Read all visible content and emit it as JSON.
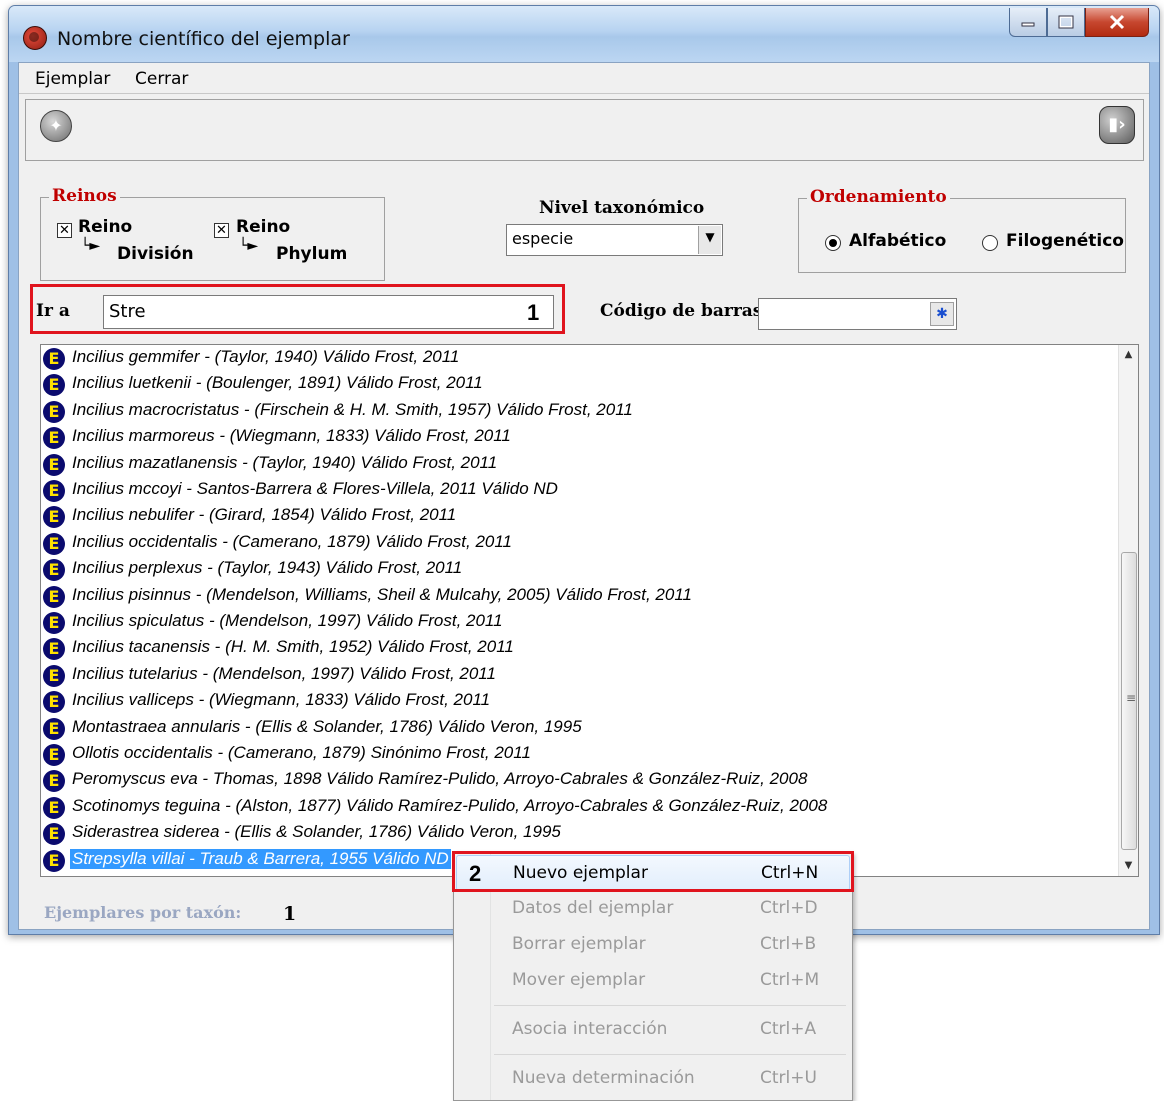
{
  "window": {
    "title": "Nombre científico del ejemplar"
  },
  "menu": [
    {
      "label": "Ejemplar"
    },
    {
      "label": "Cerrar"
    }
  ],
  "toolbar": {
    "left_icon": "new-specimen-icon",
    "right_icon": "exit-door-icon"
  },
  "reinos": {
    "title": "Reinos",
    "options": [
      {
        "line1": "Reino",
        "line2": "División",
        "checked": true
      },
      {
        "line1": "Reino",
        "line2": "Phylum",
        "checked": true
      }
    ]
  },
  "nivel": {
    "label": "Nivel taxonómico",
    "label_underline_char": "t",
    "value": "especie"
  },
  "ordenamiento": {
    "title": "Ordenamiento",
    "options": [
      {
        "label": "Alfabético",
        "selected": true
      },
      {
        "label": "Filogenético",
        "selected": false
      }
    ]
  },
  "ir_a": {
    "label": "Ir a",
    "value": "Stre",
    "step_number": "1"
  },
  "codigo": {
    "label": "Código de barras",
    "value": "",
    "button_icon": "asterisk-icon"
  },
  "list": {
    "icon_letter": "E",
    "rows": [
      "Incilius gemmifer - (Taylor, 1940)  Válido  Frost, 2011",
      "Incilius luetkenii - (Boulenger, 1891)  Válido  Frost, 2011",
      "Incilius macrocristatus - (Firschein & H. M. Smith, 1957)  Válido  Frost, 2011",
      "Incilius marmoreus - (Wiegmann, 1833)  Válido  Frost, 2011",
      "Incilius mazatlanensis - (Taylor, 1940)  Válido  Frost, 2011",
      "Incilius mccoyi - Santos-Barrera & Flores-Villela, 2011  Válido  ND",
      "Incilius nebulifer - (Girard, 1854)  Válido  Frost, 2011",
      "Incilius occidentalis - (Camerano, 1879)  Válido  Frost, 2011",
      "Incilius perplexus - (Taylor, 1943)  Válido  Frost, 2011",
      "Incilius pisinnus - (Mendelson, Williams, Sheil & Mulcahy, 2005)  Válido  Frost, 2011",
      "Incilius spiculatus - (Mendelson, 1997)  Válido  Frost, 2011",
      "Incilius tacanensis - (H. M. Smith, 1952)  Válido  Frost, 2011",
      "Incilius tutelarius - (Mendelson, 1997)  Válido  Frost, 2011",
      "Incilius valliceps - (Wiegmann, 1833)  Válido  Frost, 2011",
      "Montastraea annularis - (Ellis & Solander, 1786)  Válido  Veron, 1995",
      "Ollotis occidentalis - (Camerano, 1879)  Sinónimo   Frost, 2011",
      "Peromyscus eva - Thomas, 1898  Válido  Ramírez-Pulido, Arroyo-Cabrales & González-Ruiz, 2008",
      "Scotinomys teguina - (Alston, 1877)  Válido  Ramírez-Pulido, Arroyo-Cabrales & González-Ruiz, 2008",
      "Siderastrea siderea - (Ellis & Solander, 1786)  Válido  Veron, 1995",
      "Strepsylla villai - Traub & Barrera, 1955  Válido  ND"
    ],
    "selected_index": 19
  },
  "footer": {
    "label": "Ejemplares por taxón:",
    "value": "1"
  },
  "context_menu": {
    "step_number": "2",
    "items": [
      {
        "label": "Nuevo ejemplar",
        "shortcut": "Ctrl+N",
        "enabled": true,
        "highlighted": true
      },
      {
        "label": "Datos del ejemplar",
        "shortcut": "Ctrl+D",
        "enabled": false
      },
      {
        "label": "Borrar ejemplar",
        "shortcut": "Ctrl+B",
        "enabled": false
      },
      {
        "label": "Mover ejemplar",
        "shortcut": "Ctrl+M",
        "enabled": false
      },
      {
        "separator": true
      },
      {
        "label": "Asocia interacción",
        "shortcut": "Ctrl+A",
        "enabled": false
      },
      {
        "separator": true
      },
      {
        "label": "Nueva determinación",
        "shortcut": "Ctrl+U",
        "enabled": false
      }
    ]
  },
  "colors": {
    "annotation_red": "#e0141e",
    "selection_blue": "#3399ff",
    "group_title_red": "#c00000",
    "icon_navy": "#0b0b6e",
    "icon_yellow": "#ffe100"
  }
}
